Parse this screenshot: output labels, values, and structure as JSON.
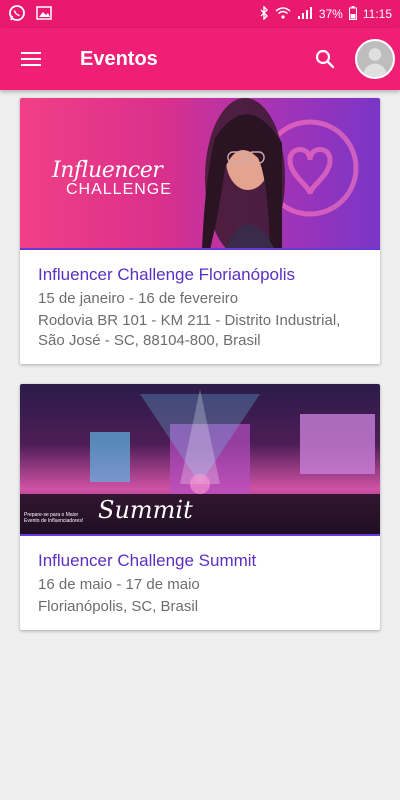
{
  "status_bar": {
    "battery": "37%",
    "time": "11:15"
  },
  "app_bar": {
    "title": "Eventos"
  },
  "events": [
    {
      "banner_text_1": "Influencer",
      "banner_text_2": "CHALLENGE",
      "title": "Influencer Challenge Florianópolis",
      "dates": "15 de janeiro - 16 de fevereiro",
      "location": "Rodovia BR 101 - KM 211 - Distrito Industrial, São José - SC, 88104-800, Brasil"
    },
    {
      "banner_text_small": "Prepare-se para o Maior Evento de Influenciadores!",
      "banner_text_script": "Summit",
      "title": "Influencer Challenge Summit",
      "dates": "16 de maio - 17 de maio",
      "location": "Florianópolis, SC, Brasil"
    }
  ],
  "colors": {
    "primary": "#f01f76",
    "status": "#e8196f",
    "title": "#5b2fc2"
  }
}
